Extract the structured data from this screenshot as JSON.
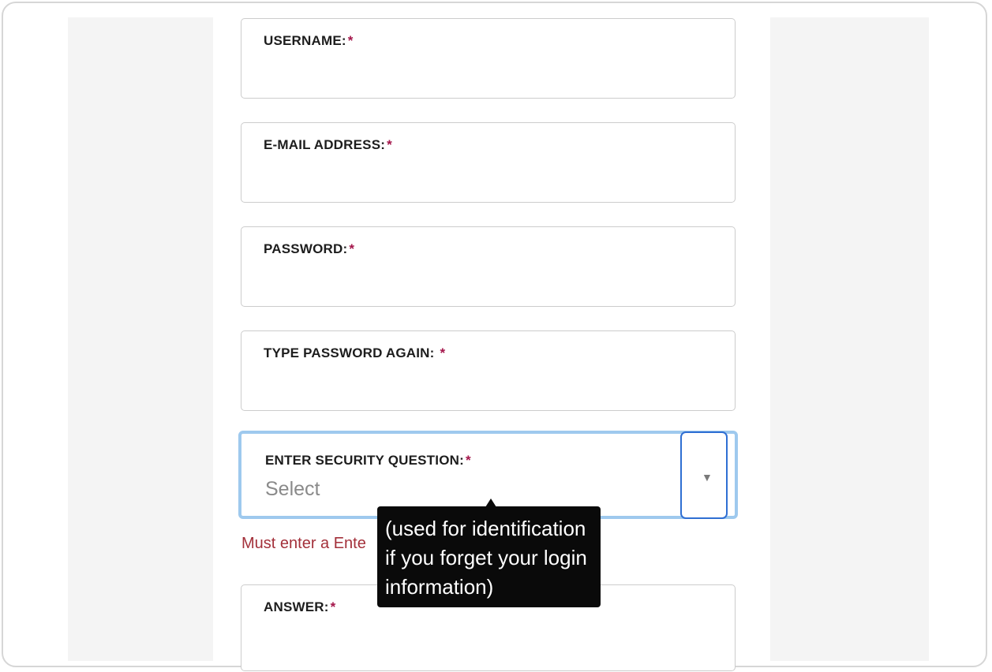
{
  "form": {
    "username": {
      "label": "USERNAME:",
      "required_mark": "*"
    },
    "email": {
      "label": "E-MAIL ADDRESS:",
      "required_mark": "*"
    },
    "password": {
      "label": "PASSWORD:",
      "required_mark": "*"
    },
    "password_again": {
      "label": "TYPE PASSWORD AGAIN: ",
      "required_mark": "*"
    },
    "security_question": {
      "label": "ENTER SECURITY QUESTION:",
      "required_mark": "*",
      "selected_value": "Select",
      "arrow_icon": "triangle-down",
      "arrow_glyph": "▼"
    },
    "error_message": "Must enter a Ente",
    "answer": {
      "label": "ANSWER:",
      "required_mark": "*"
    }
  },
  "tooltip": {
    "lines": [
      "(used for identification",
      "if you forget your login",
      "information)"
    ]
  },
  "colors": {
    "required_mark": "#a4154a",
    "error": "#a3303a",
    "focus_border": "#9ec9ee",
    "arrow_box_border": "#2f6fd3",
    "tooltip_bg": "#0a0a0a"
  }
}
